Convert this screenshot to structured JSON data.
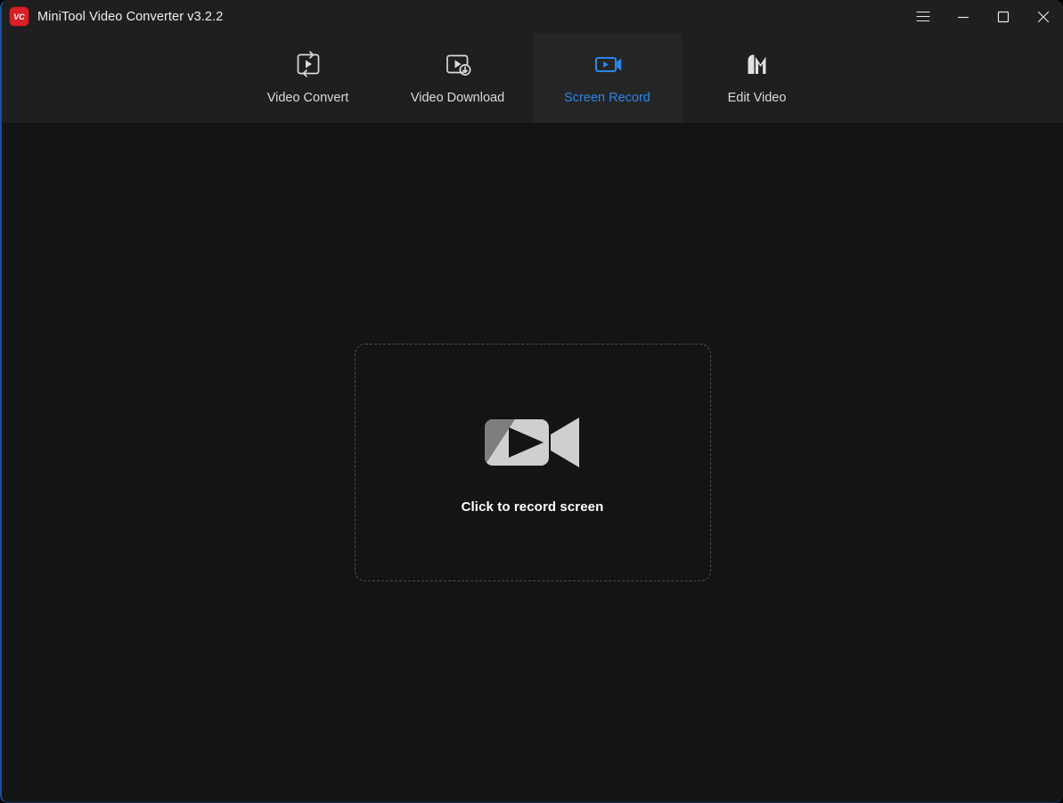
{
  "window": {
    "title": "MiniTool Video Converter v3.2.2",
    "app_icon": "vc-logo-icon",
    "app_icon_text": "VC",
    "accent_color": "#2b86e8",
    "brand_color": "#d81f26",
    "titlebar_bg": "#1f1f1f",
    "content_bg": "#141414",
    "active_tab_bg": "#252525"
  },
  "window_controls": [
    {
      "name": "menu-button",
      "icon": "hamburger-menu-icon",
      "tooltip": "Menu"
    },
    {
      "name": "minimize-button",
      "icon": "minimize-icon",
      "tooltip": "Minimize"
    },
    {
      "name": "maximize-button",
      "icon": "maximize-icon",
      "tooltip": "Maximize"
    },
    {
      "name": "close-button",
      "icon": "close-icon",
      "tooltip": "Close"
    }
  ],
  "tabs": [
    {
      "label": "Video Convert",
      "icon": "video-convert-icon",
      "active": false
    },
    {
      "label": "Video Download",
      "icon": "video-download-icon",
      "active": false
    },
    {
      "label": "Screen Record",
      "icon": "screen-record-icon",
      "active": true
    },
    {
      "label": "Edit Video",
      "icon": "edit-video-icon",
      "active": false
    }
  ],
  "main": {
    "dropzone": {
      "icon": "camcorder-icon",
      "label": "Click to record screen"
    }
  }
}
